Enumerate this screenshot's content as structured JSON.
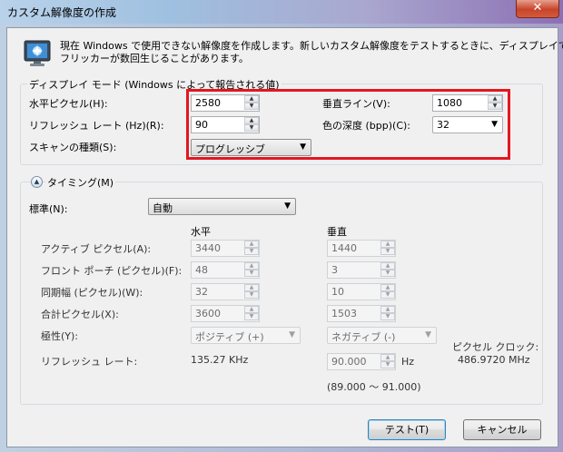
{
  "window": {
    "title": "カスタム解像度の作成",
    "close_glyph": "✕",
    "description_line1": "現在 Windows で使用できない解像度を作成します。新しいカスタム解像度をテストするときに、ディスプレイで",
    "description_line2": "フリッカーが数回生じることがあります。"
  },
  "display_mode": {
    "group_title": "ディスプレイ モード (Windows によって報告される値)",
    "horizontal_pixels_label": "水平ピクセル(H):",
    "horizontal_pixels_value": "2580",
    "vertical_lines_label": "垂直ライン(V):",
    "vertical_lines_value": "1080",
    "refresh_rate_label": "リフレッシュ レート (Hz)(R):",
    "refresh_rate_value": "90",
    "color_depth_label": "色の深度 (bpp)(C):",
    "color_depth_value": "32",
    "scan_type_label": "スキャンの種類(S):",
    "scan_type_value": "プログレッシブ"
  },
  "timing": {
    "group_title": "タイミング(M)",
    "standard_label": "標準(N):",
    "standard_value": "自動",
    "col_horizontal": "水平",
    "col_vertical": "垂直",
    "active_pixels_label": "アクティブ ピクセル(A):",
    "active_h": "3440",
    "active_v": "1440",
    "front_porch_label": "フロント ポーチ (ピクセル)(F):",
    "front_h": "48",
    "front_v": "3",
    "sync_width_label": "同期幅 (ピクセル)(W):",
    "sync_h": "32",
    "sync_v": "10",
    "total_pixels_label": "合計ピクセル(X):",
    "total_h": "3600",
    "total_v": "1503",
    "polarity_label": "極性(Y):",
    "polarity_h": "ポジティブ (+)",
    "polarity_v": "ネガティブ (-)",
    "refresh_rate_label": "リフレッシュ レート:",
    "refresh_h": "135.27 KHz",
    "refresh_v": "90.000",
    "refresh_v_unit": "Hz",
    "refresh_range": "(89.000 〜 91.000)",
    "pixel_clock_label": "ピクセル クロック:",
    "pixel_clock_value": "486.9720 MHz"
  },
  "buttons": {
    "test": "テスト(T)",
    "cancel": "キャンセル"
  },
  "icons": {
    "app": "monitor-icon",
    "expander": "chevron-up-icon"
  },
  "colors": {
    "highlight": "#e4161f",
    "window_bg": "#f0f0f0"
  }
}
